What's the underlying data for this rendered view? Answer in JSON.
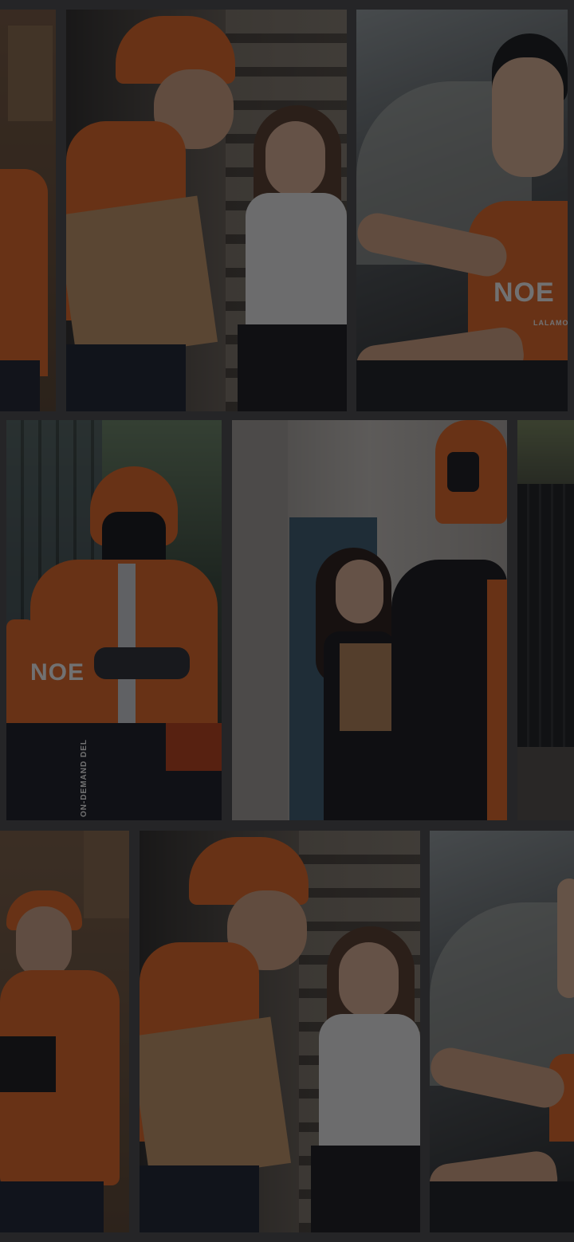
{
  "screen": {
    "background": "#4a4b4d",
    "overlay_color": "rgba(10,10,12,0.58)",
    "photo_accent": "#e96a24"
  },
  "printed_text": {
    "jacket_logo": "NOE",
    "tshirt_logo": "NOE",
    "jacket_stripe_text": "ON-DEMAND DEL",
    "tshirt_small_brand": "LALAMOVE"
  },
  "tiles": [
    {
      "name": "photo-courier-partial-left",
      "subject": "courier in orange polo"
    },
    {
      "name": "photo-courier-handing-package",
      "subject": "courier handing package to woman signing"
    },
    {
      "name": "photo-driver-in-car",
      "subject": "smiling driver in orange t-shirt"
    },
    {
      "name": "photo-rider-with-helmet",
      "subject": "rider in orange jacket checking phone"
    },
    {
      "name": "photo-doorstep-delivery",
      "subject": "woman receiving paper bag at door"
    },
    {
      "name": "photo-street-partial-right",
      "subject": "street scene"
    },
    {
      "name": "photo-courier-with-clipboard",
      "subject": "courier holding clipboard"
    },
    {
      "name": "photo-courier-handing-package-2",
      "subject": "courier handing package to woman signing"
    },
    {
      "name": "photo-driver-in-car-partial",
      "subject": "driver in car"
    }
  ]
}
